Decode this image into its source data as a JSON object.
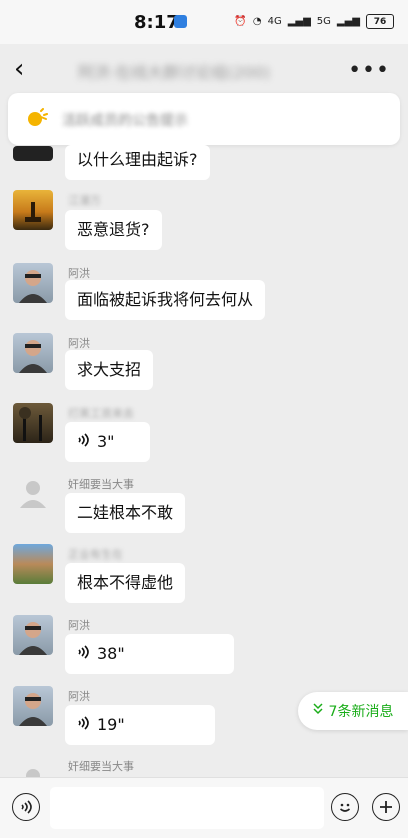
{
  "status_bar": {
    "time": "8:17",
    "network_a": "4G",
    "network_b": "5G",
    "battery": "76"
  },
  "nav": {
    "back_icon": "chevron-left-icon",
    "title": "阿洪·在线大群讨论组(200)",
    "more_icon": "more-horizontal-icon"
  },
  "notice": {
    "text": "活跃成员的公告提示"
  },
  "messages": [
    {
      "sender": "",
      "text": "以什么理由起诉?"
    },
    {
      "sender": "江漫万",
      "text": "恶意退货?"
    },
    {
      "sender": "阿洪",
      "text": "面临被起诉我将何去何从"
    },
    {
      "sender": "阿洪",
      "text": "求大支招"
    },
    {
      "sender": "打黑工资来去",
      "duration": "3\""
    },
    {
      "sender": "奸细要当大事",
      "text": "二娃根本不敢"
    },
    {
      "sender": "正业有生在",
      "text": "根本不得虚他"
    },
    {
      "sender": "阿洪",
      "duration": "38\""
    },
    {
      "sender": "阿洪",
      "duration": "19\""
    },
    {
      "sender": "奸细要当大事",
      "text": ""
    }
  ],
  "new_messages": {
    "label": "7条新消息"
  },
  "input": {
    "placeholder": ""
  },
  "colors": {
    "background": "#ededed",
    "bubble": "#ffffff",
    "accent_green": "#1aad19"
  }
}
